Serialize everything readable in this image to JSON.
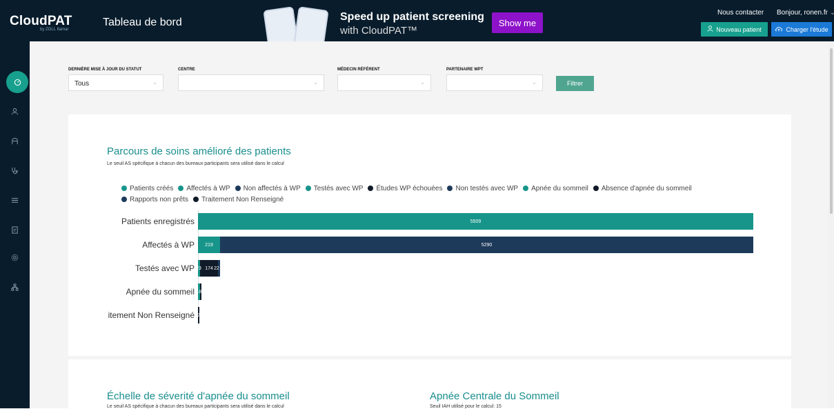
{
  "header": {
    "logo": "CloudPAT",
    "logo_sub": "by ZOLL Itamar",
    "page_title": "Tableau de bord",
    "promo_title": "Speed up patient screening",
    "promo_sub": "with CloudPAT™",
    "promo_button": "Show me",
    "contact": "Nous contacter",
    "greeting": "Bonjour, ronen.fr",
    "new_patient": "Nouveau patient",
    "upload_study": "Charger l'étude"
  },
  "sidebar": {
    "items": [
      "dashboard-icon",
      "user-icon",
      "users-icon",
      "stethoscope-icon",
      "list-icon",
      "report-icon",
      "settings-icon",
      "hierarchy-icon"
    ]
  },
  "filters": {
    "status_label": "DERNIÈRE MISE À JOUR DU STATUT",
    "status_value": "Tous",
    "center_label": "CENTRE",
    "center_value": "",
    "doctor_label": "MÉDECIN RÉFÉRENT",
    "doctor_value": "",
    "partner_label": "PARTENAIRE WPT",
    "partner_value": "",
    "filter_button": "Filtrer"
  },
  "care_path": {
    "title": "Parcours de soins amélioré des patients",
    "subtitle": "Le seuil AS spécifique à chacun des bureaux participants sera utilisé dans le calcul",
    "legend": [
      {
        "label": "Patients créés",
        "color": "#17958a"
      },
      {
        "label": "Affectés à WP",
        "color": "#17958a"
      },
      {
        "label": "Non affectés à WP",
        "color": "#1e3a5a"
      },
      {
        "label": "Testés avec WP",
        "color": "#17958a"
      },
      {
        "label": "Études WP échouées",
        "color": "#111a28"
      },
      {
        "label": "Non testés avec WP",
        "color": "#1e3a5a"
      },
      {
        "label": "Apnée du sommeil",
        "color": "#17958a"
      },
      {
        "label": "Absence d'apnée du sommeil",
        "color": "#111a28"
      },
      {
        "label": "Rapports non prêts",
        "color": "#1e3a5a"
      },
      {
        "label": "Traitement Non Renseigné",
        "color": "#111a28"
      }
    ]
  },
  "chart_data": {
    "type": "bar",
    "orientation": "horizontal",
    "stacked": true,
    "categories": [
      "Patients enregistrés",
      "Affectés à WP",
      "Testés avec WP",
      "Apnée du sommeil",
      "Traitement Non Renseigné"
    ],
    "category_labels": [
      "Patients enregistrés",
      "Affectés à WP",
      "Testés avec WP",
      "Apnée du sommeil",
      "itement Non Renseigné"
    ],
    "rows": [
      {
        "segments": [
          {
            "value": 5509,
            "label": "5509",
            "color": "#17958a"
          }
        ]
      },
      {
        "segments": [
          {
            "value": 219,
            "label": "219",
            "color": "#17958a"
          },
          {
            "value": 5290,
            "label": "5290",
            "color": "#1e3a5a"
          }
        ]
      },
      {
        "segments": [
          {
            "value": 23,
            "label": "23",
            "color": "#17958a"
          },
          {
            "value": 174,
            "label": "174",
            "color": "#111a28"
          },
          {
            "value": 22,
            "label": "22",
            "color": "#1e3a5a"
          }
        ]
      },
      {
        "segments": [
          {
            "value": 18,
            "label": "18",
            "color": "#17958a"
          },
          {
            "value": 5,
            "label": "",
            "color": "#111a28"
          }
        ]
      },
      {
        "segments": [
          {
            "value": 2,
            "label": "2",
            "color": "#111a28"
          }
        ]
      }
    ],
    "xlim": [
      0,
      5509
    ]
  },
  "severity": {
    "title": "Échelle de séverité d'apnée du sommeil",
    "subtitle": "Le seuil AS spécifique à chacun des bureaux participants sera utilisé dans le calcul"
  },
  "central": {
    "title": "Apnée Centrale du Sommeil",
    "subtitle": "Seuil IAH utilisé pour le calcul: 15"
  }
}
